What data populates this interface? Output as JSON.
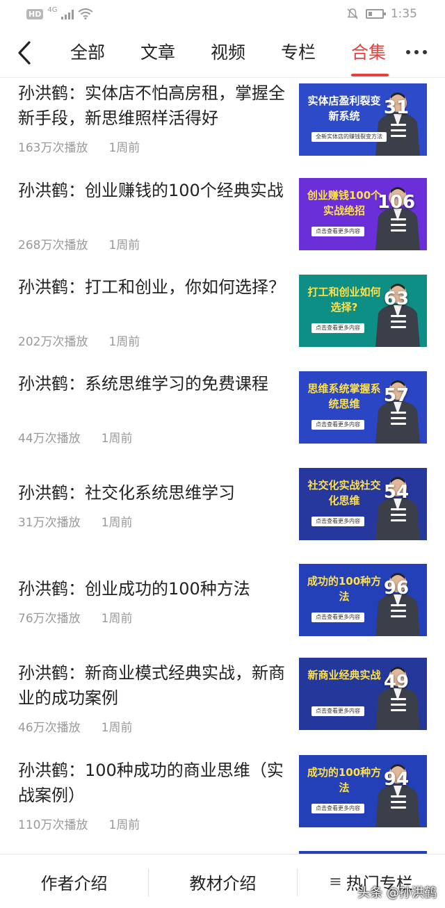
{
  "status_bar": {
    "hd": "HD",
    "net": "4G",
    "time": "1:35"
  },
  "nav": {
    "tabs": [
      {
        "label": "全部"
      },
      {
        "label": "文章"
      },
      {
        "label": "视频"
      },
      {
        "label": "专栏"
      },
      {
        "label": "合集"
      }
    ],
    "active_tab": "合集"
  },
  "items": [
    {
      "title": "孙洪鹤：实体店不怕高房租，掌握全新手段，新思维照样活得好",
      "plays": "163万次播放",
      "time": "1周前",
      "thumb_text": "实体店盈利裂变新系统",
      "thumb_cta": "全新实体店的赚钱裂变方法",
      "count": "31",
      "thumb_color": "#2d4bc8"
    },
    {
      "title": "孙洪鹤：创业赚钱的100个经典实战",
      "plays": "268万次播放",
      "time": "1周前",
      "thumb_text": "创业赚钱100个实战绝招",
      "thumb_cta": "点击查看更多内容",
      "count": "106",
      "thumb_color": "#6a2fd8"
    },
    {
      "title": "孙洪鹤：打工和创业，你如何选择？",
      "plays": "202万次播放",
      "time": "1周前",
      "thumb_text": "打工和创业如何选择?",
      "thumb_cta": "点击查看更多内容",
      "count": "63",
      "thumb_color": "#0e8f86"
    },
    {
      "title": "孙洪鹤：系统思维学习的免费课程",
      "plays": "44万次播放",
      "time": "1周前",
      "thumb_text": "思维系统掌握系统思维",
      "thumb_cta": "点击查看更多内容",
      "count": "57",
      "thumb_color": "#2a46c4"
    },
    {
      "title": "孙洪鹤：社交化系统思维学习",
      "plays": "31万次播放",
      "time": "1周前",
      "thumb_text": "社交化实战社交化思维",
      "thumb_cta": "点击查看更多内容",
      "count": "54",
      "thumb_color": "#26389e"
    },
    {
      "title": "孙洪鹤：创业成功的100种方法",
      "plays": "76万次播放",
      "time": "1周前",
      "thumb_text": "成功的100种方法",
      "thumb_cta": "点击查看更多内容",
      "count": "96",
      "thumb_color": "#2340b8"
    },
    {
      "title": "孙洪鹤：新商业模式经典实战，新商业的成功案例",
      "plays": "46万次播放",
      "time": "1周前",
      "thumb_text": "新商业经典实战",
      "thumb_cta": "点击查看更多内容",
      "count": "49",
      "thumb_color": "#23389a"
    },
    {
      "title": "孙洪鹤：100种成功的商业思维（实战案例）",
      "plays": "110万次播放",
      "time": "1周前",
      "thumb_text": "成功的100种方法",
      "thumb_cta": "点击查看更多内容",
      "count": "94",
      "thumb_color": "#2340b8"
    }
  ],
  "footer": {
    "author": "作者介绍",
    "materials": "教材介绍",
    "hot": "热门专栏"
  },
  "watermark": "头条 @孙洪鹤"
}
